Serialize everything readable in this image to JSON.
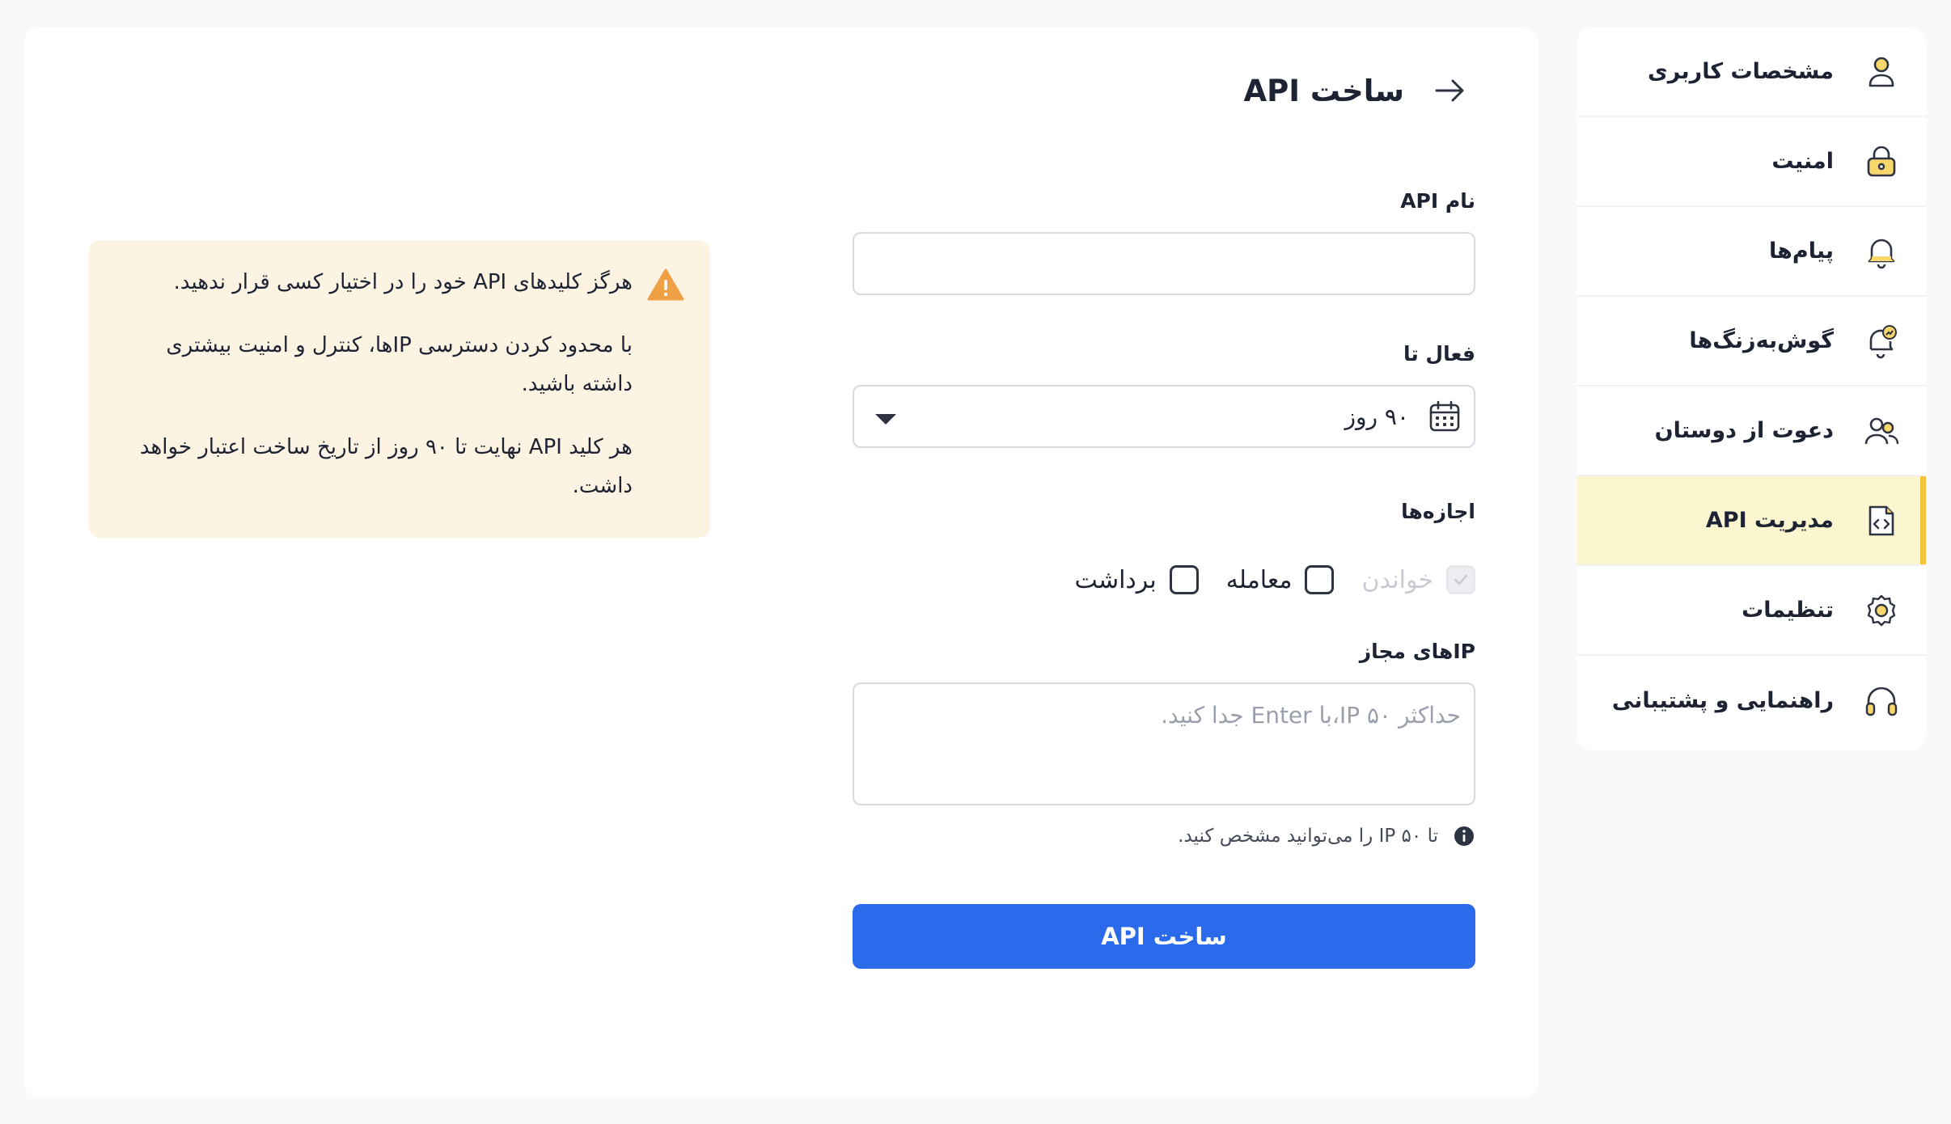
{
  "sidebar": {
    "items": [
      {
        "label": "مشخصات کاربری",
        "icon": "user-icon"
      },
      {
        "label": "امنیت",
        "icon": "lock-icon"
      },
      {
        "label": "پیام‌ها",
        "icon": "bell-icon"
      },
      {
        "label": "گوش‌به‌زنگ‌ها",
        "icon": "alert-bell-icon"
      },
      {
        "label": "دعوت از دوستان",
        "icon": "users-icon"
      },
      {
        "label": "مدیریت API",
        "icon": "code-file-icon",
        "active": true
      },
      {
        "label": "تنظیمات",
        "icon": "gear-icon"
      },
      {
        "label": "راهنمایی و پشتیبانی",
        "icon": "headset-icon"
      }
    ]
  },
  "header": {
    "title": "ساخت API",
    "back_icon": "arrow-right-icon"
  },
  "form": {
    "name_label": "نام API",
    "name_value": "",
    "active_label": "فعال تا",
    "active_value": "۹۰ روز",
    "permissions_label": "اجازه‌ها",
    "permissions": [
      {
        "label": "خواندن",
        "checked": true,
        "disabled": true
      },
      {
        "label": "معامله",
        "checked": false,
        "disabled": false
      },
      {
        "label": "برداشت",
        "checked": false,
        "disabled": false
      }
    ],
    "ips_label": "IPهای مجاز",
    "ips_placeholder": "حداکثر ۵۰ IP،با Enter جدا کنید.",
    "ips_hint": "تا ۵۰ IP را می‌توانید مشخص کنید.",
    "submit_label": "ساخت API"
  },
  "warning": {
    "lines": [
      "هرگز کلیدهای API خود را در اختیار کسی قرار ندهید.",
      "با محدود کردن دسترسی IPها، کنترل و امنیت بیشتری داشته باشید.",
      "هر کلید API نهایت تا ۹۰ روز از تاریخ ساخت اعتبار خواهد داشت."
    ]
  },
  "colors": {
    "primary": "#2b6beb",
    "accent": "#f4c53a",
    "active_bg": "#fbf6d0",
    "warning_bg": "#fcf3e2",
    "warning_icon": "#f0a044"
  }
}
